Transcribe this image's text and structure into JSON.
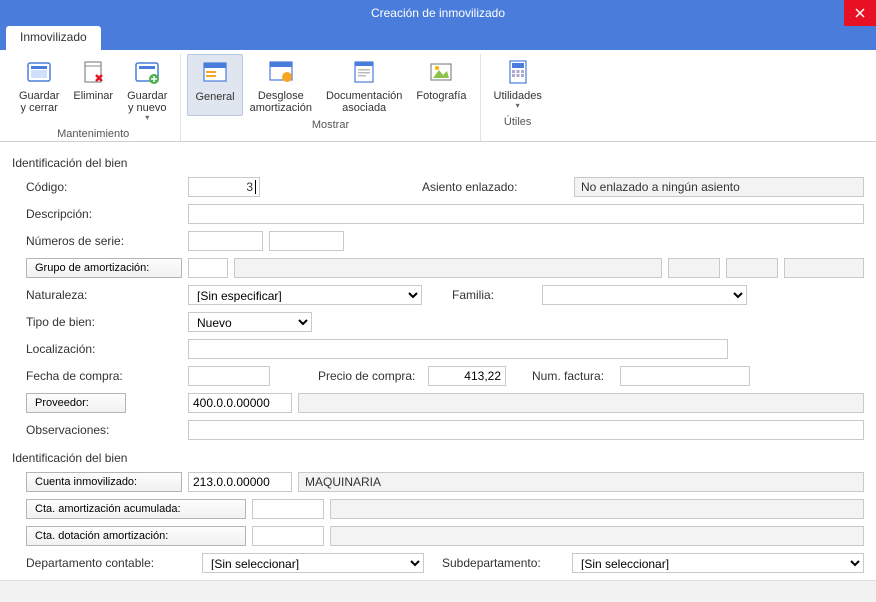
{
  "window": {
    "title": "Creación de inmovilizado"
  },
  "tab": {
    "label": "Inmovilizado"
  },
  "ribbon": {
    "maintenance": {
      "label": "Mantenimiento",
      "save_close": "Guardar\ny cerrar",
      "delete": "Eliminar",
      "save_new": "Guardar\ny nuevo"
    },
    "show": {
      "label": "Mostrar",
      "general": "General",
      "desglose": "Desglose\namortización",
      "docs": "Documentación\nasociada",
      "foto": "Fotografía"
    },
    "utils": {
      "label": "Útiles",
      "utilities": "Utilidades"
    }
  },
  "section1": {
    "title": "Identificación del bien"
  },
  "fields": {
    "codigo_label": "Código:",
    "codigo_value": "3",
    "asiento_label": "Asiento enlazado:",
    "asiento_value": "No enlazado a ningún asiento",
    "descripcion_label": "Descripción:",
    "descripcion_value": "",
    "numeros_label": "Números de serie:",
    "num1": "",
    "num2": "",
    "grupo_btn": "Grupo de amortización:",
    "grupo_code": "",
    "naturaleza_label": "Naturaleza:",
    "naturaleza_value": "[Sin especificar]",
    "familia_label": "Familia:",
    "familia_value": "",
    "tipo_label": "Tipo de bien:",
    "tipo_value": "Nuevo",
    "localizacion_label": "Localización:",
    "localizacion_value": "",
    "fecha_label": "Fecha de compra:",
    "fecha_value": "",
    "precio_label": "Precio de compra:",
    "precio_value": "413,22",
    "numfact_label": "Num. factura:",
    "numfact_value": "",
    "proveedor_btn": "Proveedor:",
    "proveedor_code": "400.0.0.00000",
    "proveedor_name": "",
    "obs_label": "Observaciones:",
    "obs_value": ""
  },
  "section2": {
    "title": "Identificación del bien"
  },
  "accounts": {
    "cuenta_btn": "Cuenta inmovilizado:",
    "cuenta_code": "213.0.0.00000",
    "cuenta_name": "MAQUINARIA",
    "ctaamort_btn": "Cta. amortización acumulada:",
    "ctaamort_code": "",
    "ctaamort_name": "",
    "ctadot_btn": "Cta. dotación amortización:",
    "ctadot_code": "",
    "ctadot_name": "",
    "dept_label": "Departamento contable:",
    "dept_value": "[Sin seleccionar]",
    "subdept_label": "Subdepartamento:",
    "subdept_value": "[Sin seleccionar]"
  }
}
